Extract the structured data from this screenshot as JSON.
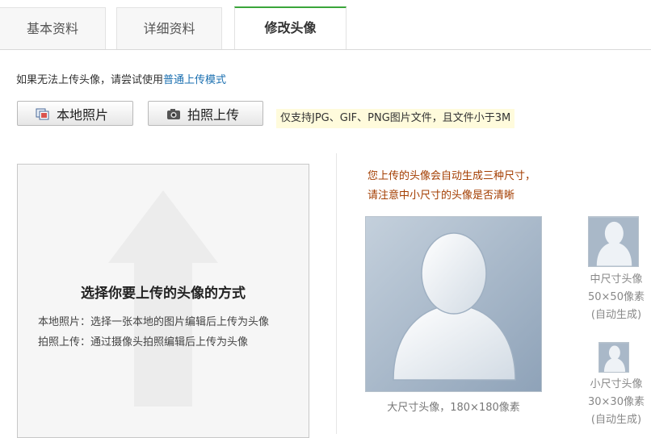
{
  "tabs": [
    {
      "label": "基本资料",
      "active": false
    },
    {
      "label": "详细资料",
      "active": false
    },
    {
      "label": "修改头像",
      "active": true
    }
  ],
  "tip": {
    "text": "如果无法上传头像，请尝试使用",
    "link": "普通上传模式"
  },
  "buttons": {
    "local_photo": {
      "label": "本地照片",
      "icon": "photo-icon"
    },
    "camera_upload": {
      "label": "拍照上传",
      "icon": "camera-icon"
    }
  },
  "notice": "仅支持JPG、GIF、PNG图片文件，且文件小于3M",
  "upload_box": {
    "title": "选择你要上传的头像的方式",
    "line1": "本地照片：选择一张本地的图片编辑后上传为头像",
    "line2": "拍照上传：通过摄像头拍照编辑后上传为头像",
    "icon": "upload-arrow-icon"
  },
  "preview": {
    "hint1": "您上传的头像会自动生成三种尺寸，",
    "hint2": "请注意中小尺寸的头像是否清晰",
    "large_caption": "大尺寸头像，180×180像素",
    "mid": {
      "line1": "中尺寸头像",
      "line2": "50×50像素",
      "line3": "(自动生成)"
    },
    "small": {
      "line1": "小尺寸头像",
      "line2": "30×30像素",
      "line3": "(自动生成)"
    }
  },
  "colors": {
    "active_tab_accent": "#3aa53a",
    "link": "#1a6fb0",
    "hint": "#a33d00",
    "notice_bg": "#fffbdc"
  }
}
